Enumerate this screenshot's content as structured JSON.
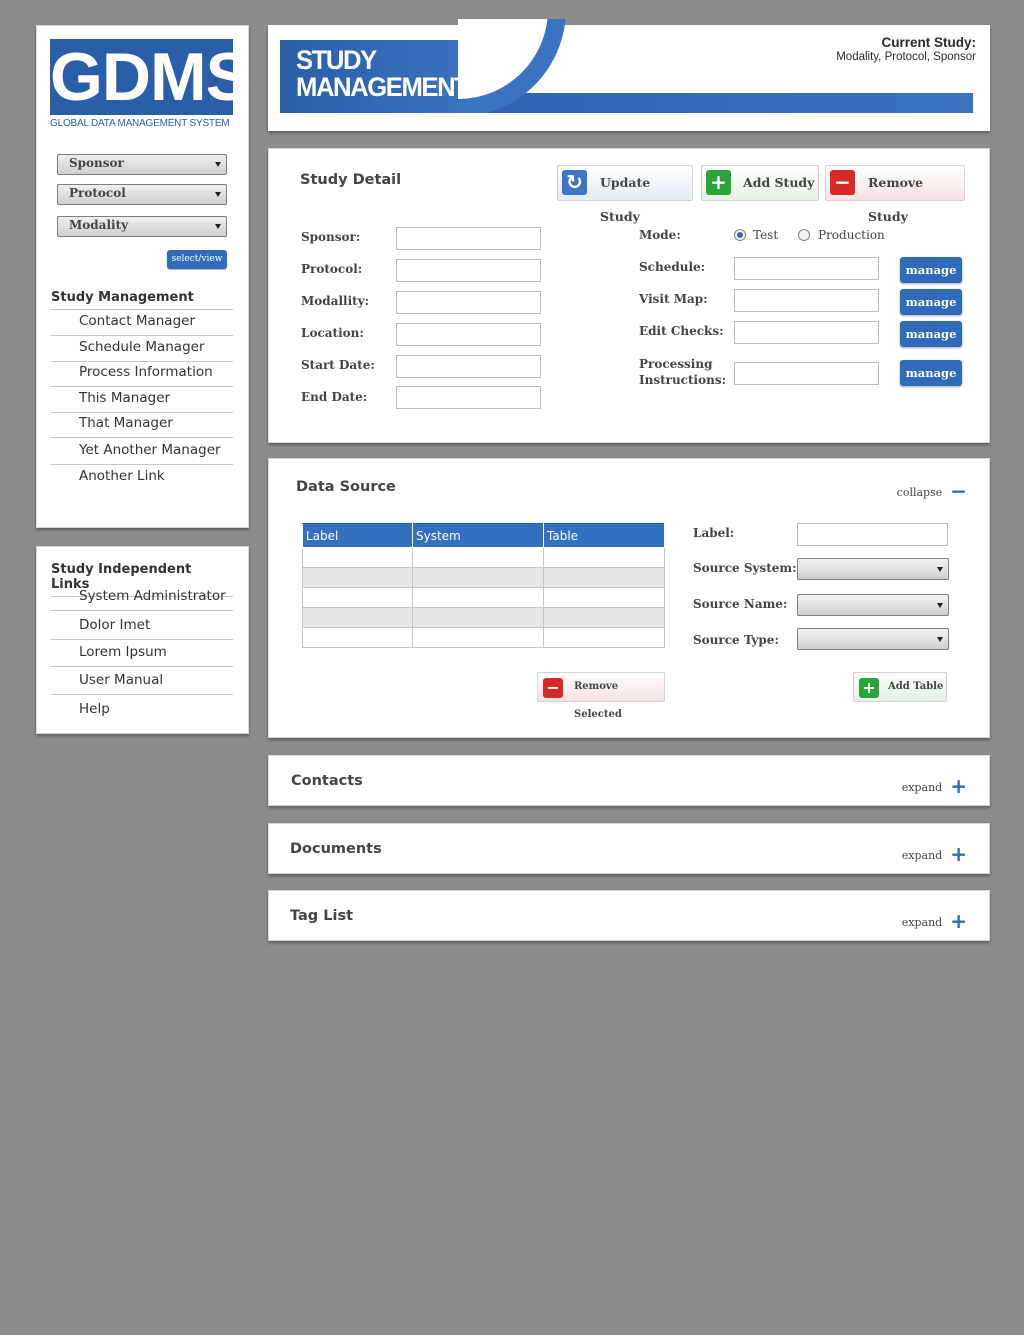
{
  "brand": {
    "logo": "GDMS",
    "subtitle": "GLOBAL DATA MANAGEMENT SYSTEM"
  },
  "filters": [
    {
      "label": "Sponsor"
    },
    {
      "label": "Protocol"
    },
    {
      "label": "Modality"
    }
  ],
  "select_view_label": "select/view",
  "nav": {
    "heading": "Study Management",
    "items": [
      "Contact Manager",
      "Schedule Manager",
      "Process Information",
      "This Manager",
      "That Manager",
      "Yet Another Manager",
      "Another Link"
    ]
  },
  "links": {
    "heading": "Study Independent Links",
    "items": [
      "System Administrator",
      "Dolor Imet",
      "Lorem Ipsum",
      "User Manual",
      "Help"
    ]
  },
  "header": {
    "title_line1": "STUDY",
    "title_line2": "MANAGEMENT",
    "current_study_label": "Current Study:",
    "current_study_value": "Modality, Protocol, Sponsor"
  },
  "study_detail": {
    "title": "Study Detail",
    "buttons": {
      "update": "Update Study",
      "add": "Add Study",
      "remove": "Remove Study"
    },
    "left_fields": [
      "Sponsor:",
      "Protocol:",
      "Modallity:",
      "Location:",
      "Start Date:",
      "End Date:"
    ],
    "mode_label": "Mode:",
    "mode_options": [
      "Test",
      "Production"
    ],
    "mode_selected": "Test",
    "right_fields": [
      "Schedule:",
      "Visit Map:",
      "Edit Checks:"
    ],
    "processing_line1": "Processing",
    "processing_line2": "Instructions:",
    "manage_label": "manage"
  },
  "data_source": {
    "title": "Data Source",
    "toggle_label": "collapse",
    "columns": [
      "Label",
      "System",
      "Table"
    ],
    "row_count": 5,
    "fields": [
      "Label:",
      "Source System:",
      "Source Name:",
      "Source Type:"
    ],
    "remove_selected": "Remove Selected",
    "add_table": "Add Table"
  },
  "sections": [
    {
      "title": "Contacts",
      "toggle": "expand"
    },
    {
      "title": "Documents",
      "toggle": "expand"
    },
    {
      "title": "Tag List",
      "toggle": "expand"
    }
  ],
  "colors": {
    "accent": "#2f6bb8",
    "add_green": "#2aa33a",
    "remove_red": "#d42a2a",
    "background": "#8c8c8c"
  }
}
